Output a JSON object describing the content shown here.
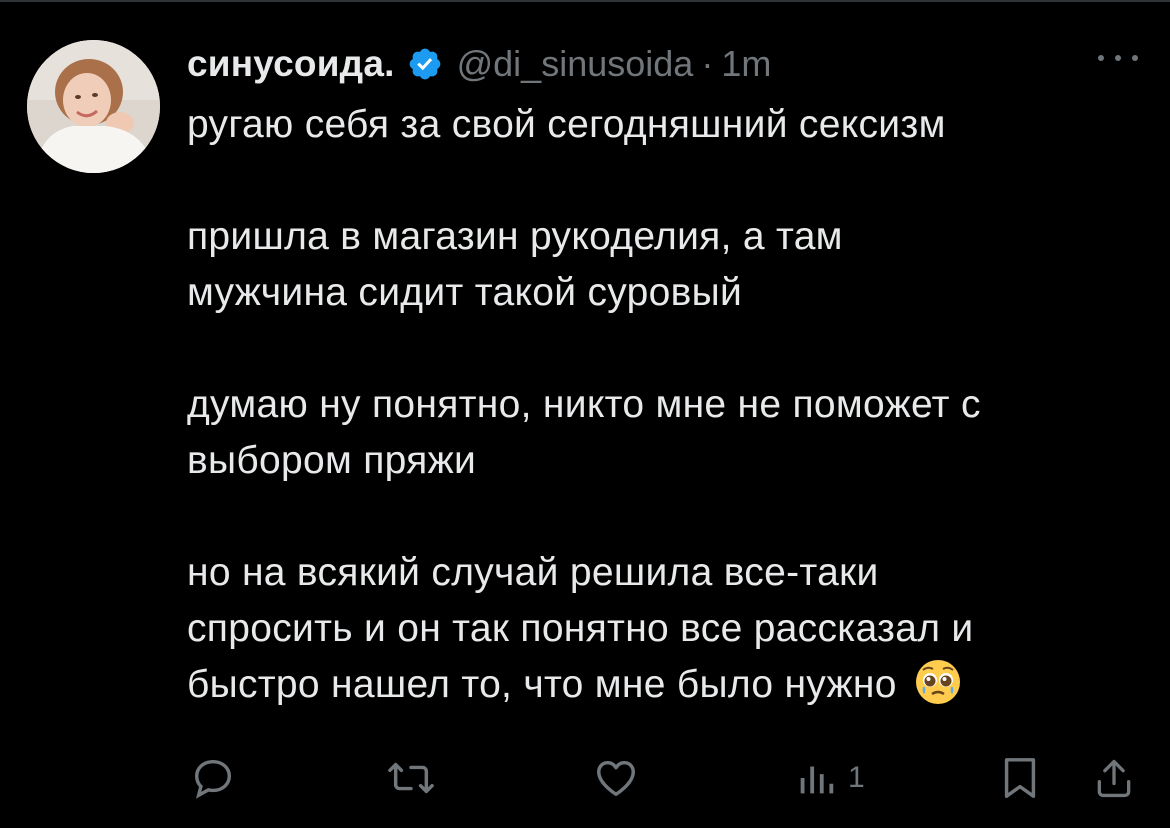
{
  "author": {
    "display_name": "синусоида.",
    "handle": "@di_sinusoida",
    "separator": "·",
    "time": "1m",
    "verified": true,
    "avatar_icon": "profile-photo"
  },
  "tweet": {
    "paragraphs": [
      [
        "ругаю себя за свой сегодняшний сексизм"
      ],
      [
        "пришла в магазин рукоделия, а там",
        "мужчина сидит такой суровый"
      ],
      [
        "думаю ну понятно, никто мне не поможет с",
        "выбором пряжи"
      ],
      [
        "но на всякий случай решила все-таки",
        "спросить и он так понятно все рассказал и",
        "быстро нашел то, что мне было нужно"
      ]
    ],
    "trailing_emoji": "pleading-face-emoji"
  },
  "actions": {
    "reply_icon": "reply-icon",
    "retweet_icon": "retweet-icon",
    "like_icon": "like-icon",
    "views_icon": "views-icon",
    "views_count": "1",
    "bookmark_icon": "bookmark-icon",
    "share_icon": "share-icon"
  },
  "colors": {
    "background": "#000000",
    "text_primary": "#E7E9EA",
    "text_secondary": "#71767B",
    "verified_blue": "#1D9BF0"
  }
}
